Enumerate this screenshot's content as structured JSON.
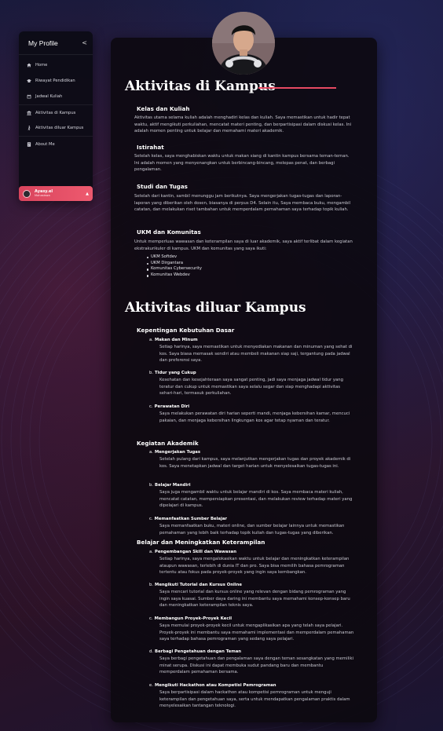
{
  "sidebar": {
    "title": "My Profile",
    "collapse_icon": "<",
    "items": [
      {
        "label": "Home",
        "icon": "home-icon"
      },
      {
        "label": "Riwayat Pendidikan",
        "icon": "graduation-cap-icon"
      },
      {
        "label": "Jadwal Kuliah",
        "icon": "calendar-icon"
      },
      {
        "label": "Aktivitas di Kampus",
        "icon": "building-icon"
      },
      {
        "label": "Aktivitas diluar Kampus",
        "icon": "walking-icon"
      },
      {
        "label": "About Me",
        "icon": "id-card-icon"
      }
    ],
    "user": {
      "name": "Ayasy.el",
      "role": "Mahasiswa",
      "caret": "▲"
    }
  },
  "section1": {
    "title": "Aktivitas di Kampus",
    "blocks": [
      {
        "heading": "Kelas dan Kuliah",
        "text": "Aktivitas utama selama kuliah adalah menghadiri kelas dan kuliah. Saya memastikan untuk hadir tepat waktu, aktif mengikuti perkuliahan, mencatat materi penting, dan berpartisipasi dalam diskusi kelas. Ini adalah momen penting untuk belajar dan memahami materi akademik."
      },
      {
        "heading": "Istirahat",
        "text": "Setelah kelas, saya menghabiskan waktu untuk makan siang di kantin kampus bersama teman-teman. Ini adalah momen yang menyenangkan untuk berbincang-bincang, melepas penat, dan berbagi pengalaman."
      },
      {
        "heading": "Studi dan Tugas",
        "text": "Setelah dari kantin, sambil menunggu jam berikutnya. Saya mengerjakan tugas-tugas dan laporan-laporan yang diberikan oleh dosen, biasanya di perpus D4. Selain itu, Saya membaca buku, mengambil catatan, dan melakukan riset tambahan untuk memperdalam pemahaman saya terhadap topik kuliah."
      },
      {
        "heading": "UKM dan Komunitas",
        "text": "Untuk memperluas wawasan dan keterampilan saya di luar akademik, saya aktif terlibat dalam kegiatan ekstrakurikuler di kampus. UKM dan komunitas yang saya ikuti:"
      }
    ],
    "ukm_list": [
      "UKM Softdev",
      "UKM Dirgantara",
      "Komunitas Cybersecurity",
      "Komunitas Webdev"
    ]
  },
  "section2": {
    "title": "Aktivitas diluar Kampus",
    "groups": [
      {
        "heading": "Kepentingan Kebutuhan Dasar",
        "items": [
          {
            "letter": "a.",
            "title": "Makan dan Minum",
            "text": "Setiap harinya, saya memastikan untuk menyediakan makanan dan minuman yang sehat di kos. Saya biasa memasak sendiri atau membeli makanan siap saji, tergantung pada jadwal dan preferensi saya."
          },
          {
            "letter": "b.",
            "title": "Tidur yang Cukup",
            "text": "Kesehatan dan kesejahteraan saya sangat penting, jadi saya menjaga jadwal tidur yang teratur dan cukup untuk memastikan saya selalu segar dan siap menghadapi aktivitas sehari-hari, termasuk perkuliahan."
          },
          {
            "letter": "c.",
            "title": "Perawatan Diri",
            "text": "Saya melakukan perawatan diri harian seperti mandi, menjaga kebersihan kamar, mencuci pakaian, dan menjaga kebersihan lingkungan kos agar tetap nyaman dan teratur."
          }
        ]
      },
      {
        "heading": "Kegiatan Akademik",
        "items": [
          {
            "letter": "a.",
            "title": "Mengerjakan Tugas",
            "text": "Setelah pulang dari kampus, saya melanjutkan mengerjakan tugas dan proyek akademik di kos. Saya menetapkan jadwal dan target harian untuk menyelesaikan tugas-tugas ini."
          },
          {
            "letter": "b.",
            "title": "Belajar Mandiri",
            "text": "Saya juga mengambil waktu untuk belajar mandiri di kos. Saya membaca materi kuliah, mencatat catatan, mempersiapkan presentasi, dan melakukan review terhadap materi yang dipelajari di kampus."
          },
          {
            "letter": "c.",
            "title": "Memanfaatkan Sumber Belajar",
            "text": "Saya memanfaatkan buku, materi online, dan sumber belajar lainnya untuk memastikan pemahaman yang lebih baik terhadap topik kuliah dan tugas-tugas yang diberikan."
          }
        ]
      },
      {
        "heading": "Belajar dan Meningkatkan Keterampilan",
        "items": [
          {
            "letter": "a.",
            "title": "Pengembangan Skill dan Wawasan",
            "text": "Setiap harinya, saya mengalokasikan waktu untuk belajar dan meningkatkan keterampilan ataupun wawasan, terlebih di dunia IT dan pro. Saya bisa memilih bahasa pemrograman tertentu atau fokus pada proyek-proyek yang ingin saya kembangkan."
          },
          {
            "letter": "b.",
            "title": "Mengikuti Tutorial dan Kursus Online",
            "text": "Saya mencari tutorial dan kursus online yang relevan dengan bidang pemrograman yang ingin saya kuasai. Sumber daya daring ini membantu saya memahami konsep-konsep baru dan meningkatkan keterampilan teknis saya."
          },
          {
            "letter": "c.",
            "title": "Membangun Proyek-Proyek Kecil",
            "text": "Saya memulai proyek-proyek kecil untuk mengaplikasikan apa yang telah saya pelajari. Proyek-proyek ini membantu saya memahami implementasi dan memperdalam pemahaman saya terhadap bahasa pemrograman yang sedang saya pelajari."
          },
          {
            "letter": "d.",
            "title": "Berbagi Pengetahuan dengan Teman",
            "text": "Saya berbagi pengetahuan dan pengalaman saya dengan teman sesangkatan yang memiliki minat serupa. Diskusi ini dapat membuka sudut pandang baru dan membantu memperdalam pemahaman bersama."
          },
          {
            "letter": "e.",
            "title": "Mengikuti Hackathon atau Kompetisi Pemrograman",
            "text": "Saya berpartisipasi dalam hackathon atau kompetisi pemrograman untuk menguji keterampilan dan pengetahuan saya, serta untuk mendapatkan pengalaman praktis dalam menyelesaikan tantangan teknologi."
          }
        ]
      }
    ]
  },
  "colors": {
    "accent": "#e64a62",
    "card": "#0c0910",
    "sidebar": "#0a0a12"
  }
}
